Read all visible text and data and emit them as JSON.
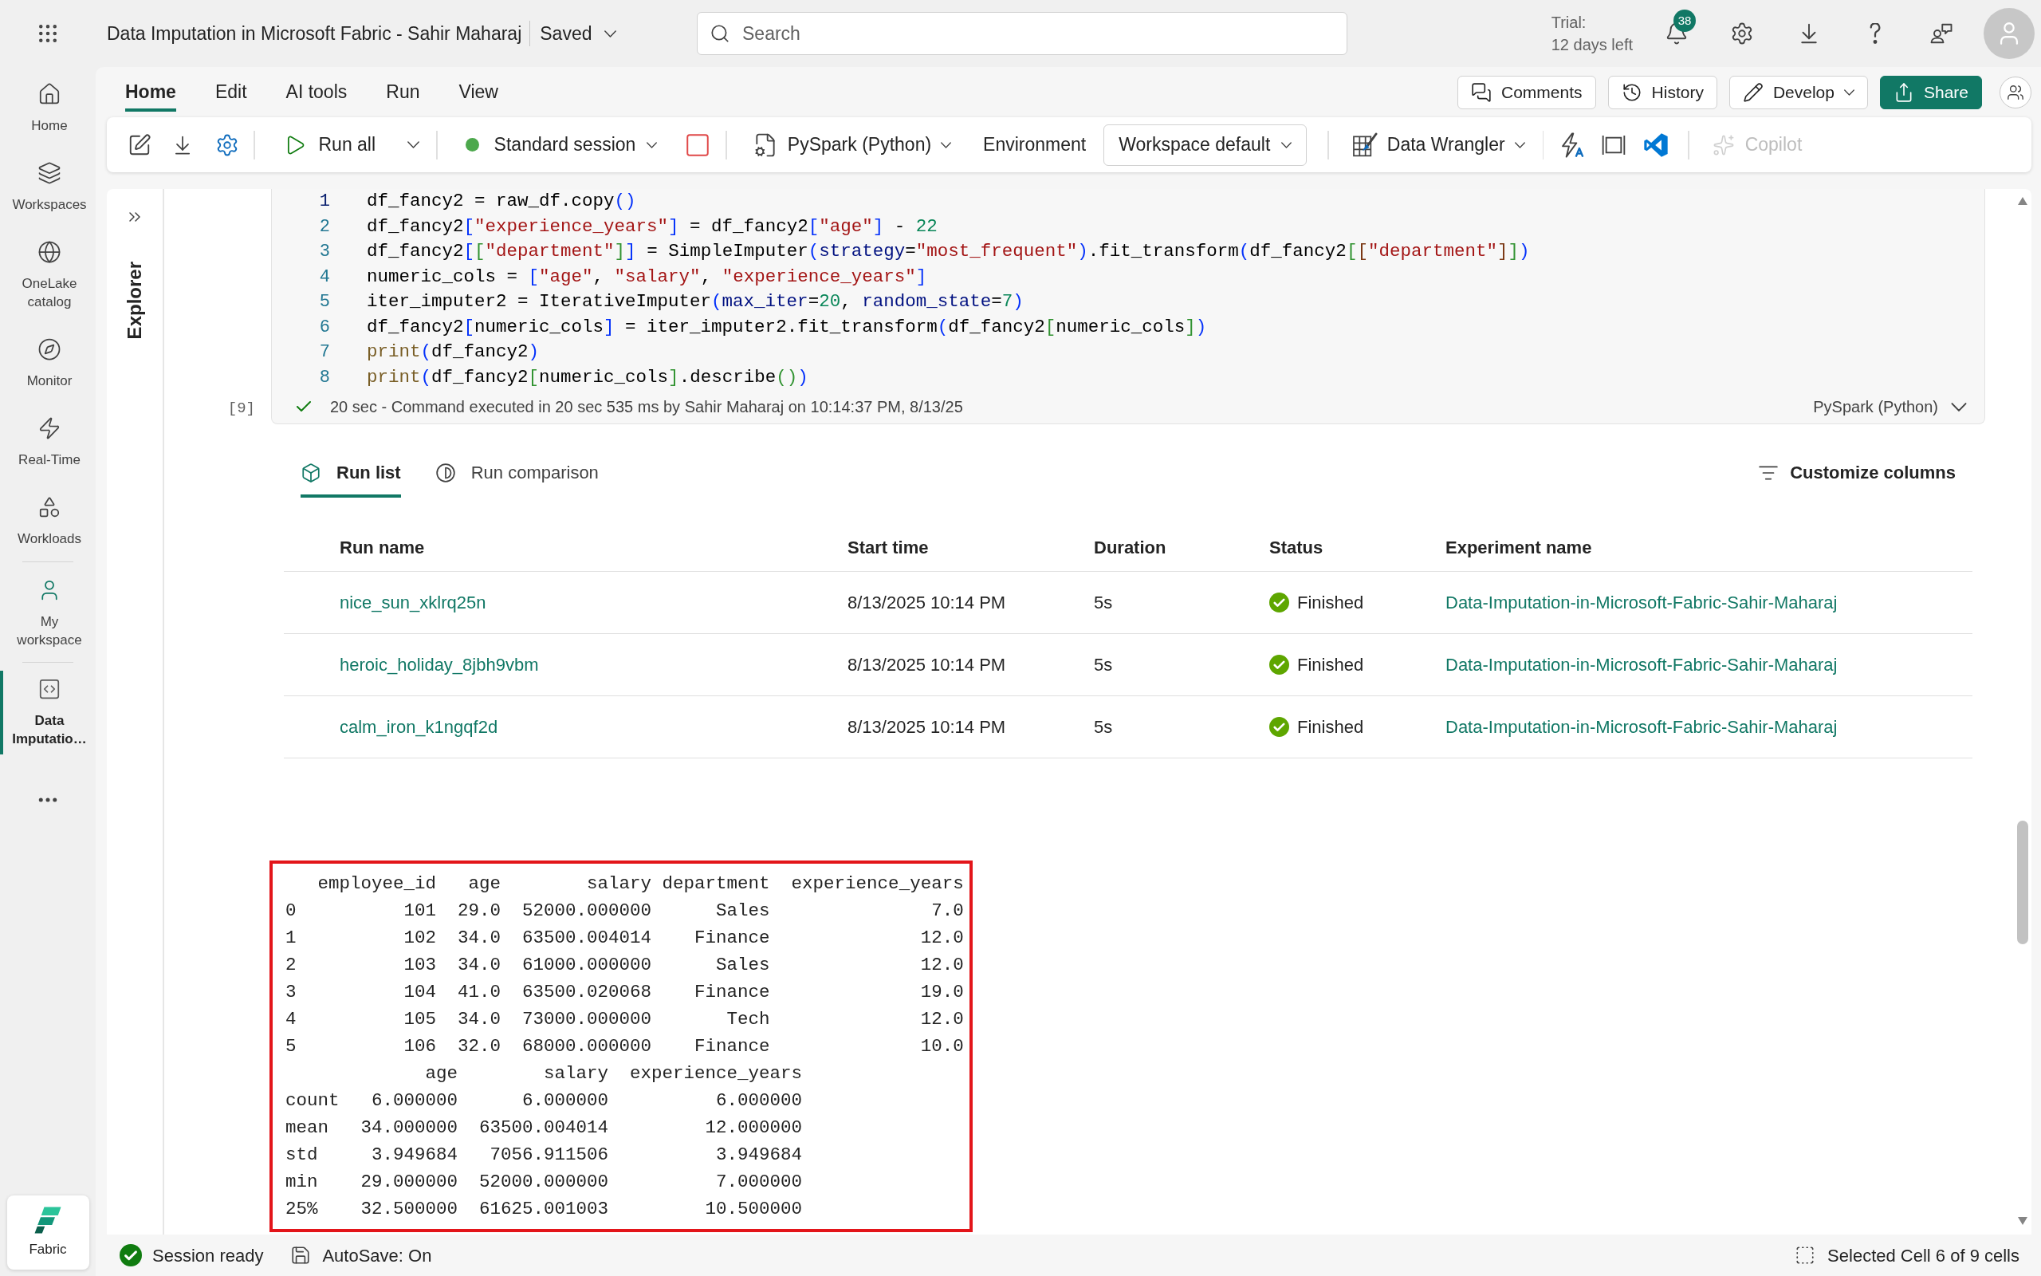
{
  "app_bar": {
    "title": "Data Imputation in Microsoft Fabric - Sahir Maharaj",
    "save_state": "Saved",
    "search": {
      "placeholder": "Search"
    },
    "trial": {
      "label": "Trial:",
      "remaining": "12 days left"
    },
    "notification_count": "38"
  },
  "nav": {
    "sections": [
      {
        "items": [
          {
            "label": "Home",
            "selected": false
          },
          {
            "label": "Workspaces",
            "selected": false
          },
          {
            "label": "OneLake catalog",
            "selected": false
          },
          {
            "label": "Monitor",
            "selected": false
          },
          {
            "label": "Real-Time",
            "selected": false
          },
          {
            "label": "Workloads",
            "selected": false
          }
        ]
      },
      {
        "items": [
          {
            "label": "My workspace",
            "selected": false
          }
        ]
      },
      {
        "items": [
          {
            "label": "Data Imputatio…",
            "selected": true
          }
        ]
      }
    ],
    "product": "Fabric"
  },
  "ribbon": {
    "tabs": [
      {
        "label": "Home",
        "selected": true
      },
      {
        "label": "Edit",
        "selected": false
      },
      {
        "label": "AI tools",
        "selected": false
      },
      {
        "label": "Run",
        "selected": false
      },
      {
        "label": "View",
        "selected": false
      }
    ],
    "actions": [
      {
        "label": "Comments",
        "kind": "outline"
      },
      {
        "label": "History",
        "kind": "outline"
      },
      {
        "label": "Develop",
        "kind": "menu"
      },
      {
        "label": "Share",
        "kind": "primary"
      }
    ]
  },
  "toolbar": {
    "run_all": "Run all",
    "session": "Standard session",
    "language": "PySpark (Python)",
    "environment": {
      "label": "Environment",
      "value": "Workspace default"
    },
    "data_wrangler": "Data Wrangler",
    "copilot": {
      "label": "Copilot",
      "disabled": true
    }
  },
  "explorer": {
    "label": "Explorer"
  },
  "code_cell": {
    "execution_count": "[9]",
    "lines": [
      {
        "number": "1",
        "current": true,
        "tokens": [
          {
            "text": "df_fancy2 = raw_df.copy",
            "kind": "plain"
          },
          {
            "text": "()",
            "kind": "bracket"
          }
        ]
      },
      {
        "number": "2",
        "current": false,
        "tokens": [
          {
            "text": "df_fancy2",
            "kind": "plain"
          },
          {
            "text": "[",
            "kind": "bracket"
          },
          {
            "text": "\"experience_years\"",
            "kind": "string"
          },
          {
            "text": "]",
            "kind": "bracket"
          },
          {
            "text": " = df_fancy2",
            "kind": "plain"
          },
          {
            "text": "[",
            "kind": "bracket"
          },
          {
            "text": "\"age\"",
            "kind": "string"
          },
          {
            "text": "]",
            "kind": "bracket"
          },
          {
            "text": " - ",
            "kind": "plain"
          },
          {
            "text": "22",
            "kind": "number"
          }
        ]
      },
      {
        "number": "3",
        "current": false,
        "tokens": [
          {
            "text": "df_fancy2",
            "kind": "plain"
          },
          {
            "text": "[",
            "kind": "bracket"
          },
          {
            "text": "[",
            "kind": "nested"
          },
          {
            "text": "\"department\"",
            "kind": "string"
          },
          {
            "text": "]",
            "kind": "nested"
          },
          {
            "text": "]",
            "kind": "bracket"
          },
          {
            "text": " = SimpleImputer",
            "kind": "plain"
          },
          {
            "text": "(",
            "kind": "bracket"
          },
          {
            "text": "strategy",
            "kind": "param"
          },
          {
            "text": "=",
            "kind": "plain"
          },
          {
            "text": "\"most_frequent\"",
            "kind": "string"
          },
          {
            "text": ")",
            "kind": "bracket"
          },
          {
            "text": ".fit_transform",
            "kind": "plain"
          },
          {
            "text": "(",
            "kind": "bracket"
          },
          {
            "text": "df_fancy2",
            "kind": "plain"
          },
          {
            "text": "[",
            "kind": "nested"
          },
          {
            "text": "[",
            "kind": "deep"
          },
          {
            "text": "\"department\"",
            "kind": "string"
          },
          {
            "text": "]",
            "kind": "deep"
          },
          {
            "text": "]",
            "kind": "nested"
          },
          {
            "text": ")",
            "kind": "bracket"
          }
        ]
      },
      {
        "number": "4",
        "current": false,
        "tokens": [
          {
            "text": "numeric_cols = ",
            "kind": "plain"
          },
          {
            "text": "[",
            "kind": "bracket"
          },
          {
            "text": "\"age\"",
            "kind": "string"
          },
          {
            "text": ", ",
            "kind": "plain"
          },
          {
            "text": "\"salary\"",
            "kind": "string"
          },
          {
            "text": ", ",
            "kind": "plain"
          },
          {
            "text": "\"experience_years\"",
            "kind": "string"
          },
          {
            "text": "]",
            "kind": "bracket"
          }
        ]
      },
      {
        "number": "5",
        "current": false,
        "tokens": [
          {
            "text": "iter_imputer2 = IterativeImputer",
            "kind": "plain"
          },
          {
            "text": "(",
            "kind": "bracket"
          },
          {
            "text": "max_iter",
            "kind": "param"
          },
          {
            "text": "=",
            "kind": "plain"
          },
          {
            "text": "20",
            "kind": "number"
          },
          {
            "text": ", ",
            "kind": "plain"
          },
          {
            "text": "random_state",
            "kind": "param"
          },
          {
            "text": "=",
            "kind": "plain"
          },
          {
            "text": "7",
            "kind": "number"
          },
          {
            "text": ")",
            "kind": "bracket"
          }
        ]
      },
      {
        "number": "6",
        "current": false,
        "tokens": [
          {
            "text": "df_fancy2",
            "kind": "plain"
          },
          {
            "text": "[",
            "kind": "bracket"
          },
          {
            "text": "numeric_cols",
            "kind": "plain"
          },
          {
            "text": "]",
            "kind": "bracket"
          },
          {
            "text": " = iter_imputer2.fit_transform",
            "kind": "plain"
          },
          {
            "text": "(",
            "kind": "bracket"
          },
          {
            "text": "df_fancy2",
            "kind": "plain"
          },
          {
            "text": "[",
            "kind": "nested"
          },
          {
            "text": "numeric_cols",
            "kind": "plain"
          },
          {
            "text": "]",
            "kind": "nested"
          },
          {
            "text": ")",
            "kind": "bracket"
          }
        ]
      },
      {
        "number": "7",
        "current": false,
        "tokens": [
          {
            "text": "print",
            "kind": "builtin"
          },
          {
            "text": "(",
            "kind": "bracket"
          },
          {
            "text": "df_fancy2",
            "kind": "plain"
          },
          {
            "text": ")",
            "kind": "bracket"
          }
        ]
      },
      {
        "number": "8",
        "current": false,
        "tokens": [
          {
            "text": "print",
            "kind": "builtin"
          },
          {
            "text": "(",
            "kind": "bracket"
          },
          {
            "text": "df_fancy2",
            "kind": "plain"
          },
          {
            "text": "[",
            "kind": "nested"
          },
          {
            "text": "numeric_cols",
            "kind": "plain"
          },
          {
            "text": "]",
            "kind": "nested"
          },
          {
            "text": ".describe",
            "kind": "plain"
          },
          {
            "text": "()",
            "kind": "nested"
          },
          {
            "text": ")",
            "kind": "bracket"
          }
        ]
      }
    ],
    "status": "20 sec - Command executed in 20 sec 535 ms by Sahir Maharaj on 10:14:37 PM, 8/13/25",
    "language": "PySpark (Python)"
  },
  "run_list": {
    "tabs": [
      {
        "label": "Run list",
        "selected": true
      },
      {
        "label": "Run comparison",
        "selected": false
      }
    ],
    "customize": "Customize columns",
    "columns": [
      "Run name",
      "Start time",
      "Duration",
      "Status",
      "Experiment name"
    ],
    "rows": [
      {
        "run_name": "nice_sun_xklrq25n",
        "start_time": "8/13/2025 10:14 PM",
        "duration": "5s",
        "status": "Finished",
        "experiment": "Data-Imputation-in-Microsoft-Fabric-Sahir-Maharaj"
      },
      {
        "run_name": "heroic_holiday_8jbh9vbm",
        "start_time": "8/13/2025 10:14 PM",
        "duration": "5s",
        "status": "Finished",
        "experiment": "Data-Imputation-in-Microsoft-Fabric-Sahir-Maharaj"
      },
      {
        "run_name": "calm_iron_k1ngqf2d",
        "start_time": "8/13/2025 10:14 PM",
        "duration": "5s",
        "status": "Finished",
        "experiment": "Data-Imputation-in-Microsoft-Fabric-Sahir-Maharaj"
      }
    ]
  },
  "output": {
    "lines": [
      "   employee_id   age        salary department  experience_years",
      "0          101  29.0  52000.000000      Sales               7.0",
      "1          102  34.0  63500.004014    Finance              12.0",
      "2          103  34.0  61000.000000      Sales              12.0",
      "3          104  41.0  63500.020068    Finance              19.0",
      "4          105  34.0  73000.000000       Tech              12.0",
      "5          106  32.0  68000.000000    Finance              10.0",
      "             age        salary  experience_years",
      "count   6.000000      6.000000          6.000000",
      "mean   34.000000  63500.004014         12.000000",
      "std     3.949684   7056.911506          3.949684",
      "min    29.000000  52000.000000          7.000000",
      "25%    32.500000  61625.001003         10.500000"
    ]
  },
  "status_bar": {
    "session": "Session ready",
    "autosave": "AutoSave: On",
    "selection": "Selected Cell 6 of 9 cells"
  }
}
